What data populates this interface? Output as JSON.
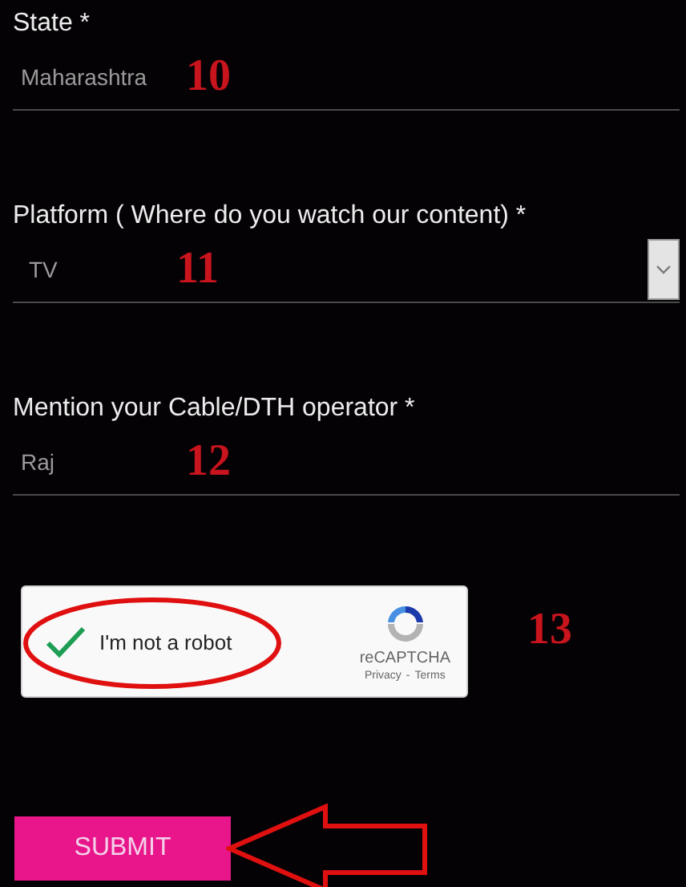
{
  "fields": [
    {
      "kind": "text",
      "label": "State *",
      "value": "Maharashtra",
      "annotation": "10"
    },
    {
      "kind": "select",
      "label": "Platform ( Where do you watch our content) *",
      "value": "TV",
      "annotation": "11"
    },
    {
      "kind": "text",
      "label": "Mention your Cable/DTH operator *",
      "value": "Raj",
      "annotation": "12"
    }
  ],
  "captcha": {
    "checked": true,
    "label": "I'm not a robot",
    "brand": "reCAPTCHA",
    "privacy_link": "Privacy",
    "link_separator": "-",
    "terms_link": "Terms",
    "annotation": "13"
  },
  "submit": {
    "label": "SUBMIT"
  }
}
